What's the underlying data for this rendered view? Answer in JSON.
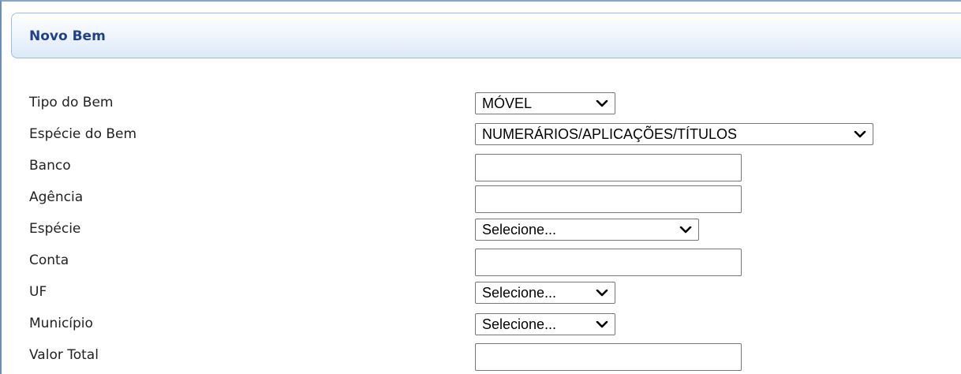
{
  "panel": {
    "title": "Novo Bem"
  },
  "form": {
    "fields": [
      {
        "label": "Tipo do Bem",
        "type": "select",
        "value": "MÓVEL"
      },
      {
        "label": "Espécie do Bem",
        "type": "select",
        "value": "NUMERÁRIOS/APLICAÇÕES/TÍTULOS"
      },
      {
        "label": "Banco",
        "type": "text",
        "value": ""
      },
      {
        "label": "Agência",
        "type": "text",
        "value": ""
      },
      {
        "label": "Espécie",
        "type": "select",
        "value": "Selecione..."
      },
      {
        "label": "Conta",
        "type": "text",
        "value": ""
      },
      {
        "label": "UF",
        "type": "select",
        "value": "Selecione..."
      },
      {
        "label": "Município",
        "type": "select",
        "value": "Selecione..."
      },
      {
        "label": "Valor Total",
        "type": "text",
        "value": ""
      }
    ]
  },
  "icons": {
    "dropdown": "chevron-down-icon"
  },
  "colors": {
    "title": "#1f3f8f",
    "header_border": "#9fbde0",
    "header_gradient_bottom": "#dce9f8",
    "field_border": "#767676"
  }
}
